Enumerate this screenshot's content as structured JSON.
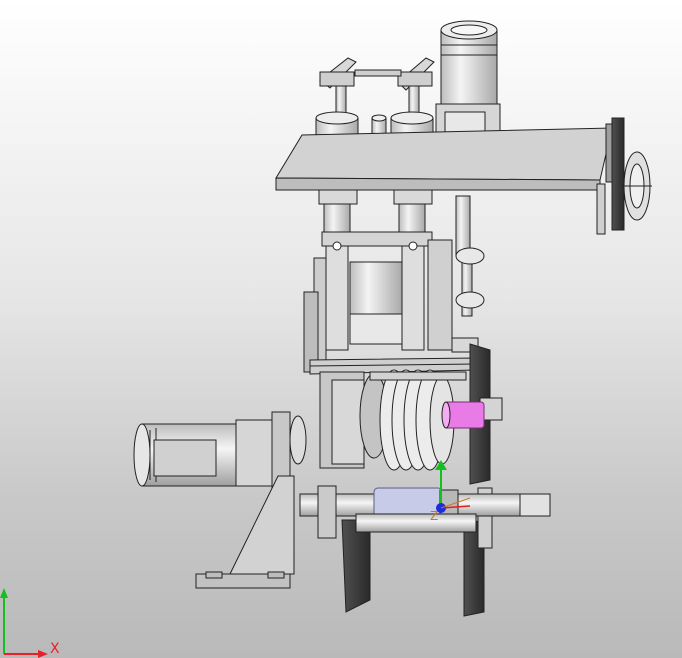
{
  "viewport": {
    "background_top": "#ffffff",
    "background_bottom": "#bababa"
  },
  "triad": {
    "x_label": "X",
    "x_color": "#e8202a",
    "y_color": "#12c020"
  },
  "origin": {
    "z_label": "Z",
    "x_color": "#e02020",
    "y_color": "#12c020",
    "z_color": "#1e2bd8",
    "z_label_color": "#c8782a"
  },
  "model": {
    "body_color": "#e4e4e4",
    "edge_color": "#222222",
    "highlight_pink": "#e97be6",
    "highlight_blue": "#c7cbe8"
  }
}
